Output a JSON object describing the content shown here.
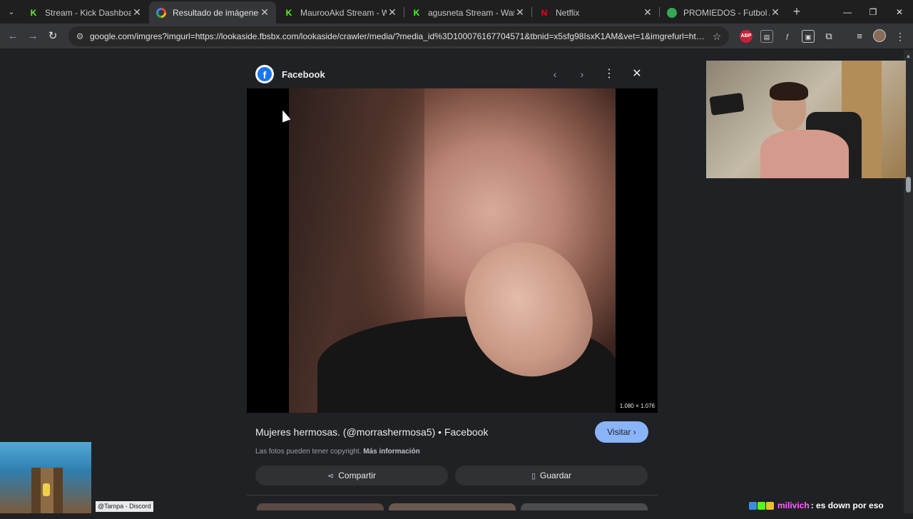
{
  "browser": {
    "tabs": [
      {
        "label": "Stream - Kick Dashboard",
        "icon": "kick-icon"
      },
      {
        "label": "Resultado de imágenes de G",
        "icon": "google-icon"
      },
      {
        "label": "MaurooAkd Stream - Watch",
        "icon": "kick-icon"
      },
      {
        "label": "agusneta Stream - Watch Liv",
        "icon": "kick-icon"
      },
      {
        "label": "Netflix",
        "icon": "netflix-icon"
      },
      {
        "label": "PROMIEDOS - Futbol Argent",
        "icon": "promiedos-icon"
      }
    ],
    "url": "google.com/imgres?imgurl=https://lookaside.fbsbx.com/lookaside/crawler/media/?media_id%3D100076167704571&tbnid=x5sfg98IsxK1AM&vet=1&imgrefurl=https://www...",
    "extensions": [
      "ABP",
      "reader-icon",
      "script-icon",
      "media-icon",
      "puzzle-icon",
      "queue-icon"
    ]
  },
  "panel": {
    "source": "Facebook",
    "image_dims": "1.080 × 1.076",
    "caption": "Mujeres hermosas. (@morrashermosa5) • Facebook",
    "visit_label": "Visitar",
    "copyright_text": "Las fotos pueden tener copyright.",
    "more_info": "Más información",
    "share_label": "Compartir",
    "save_label": "Guardar"
  },
  "overlay": {
    "discord_tag": "@Tampa - Discord",
    "chat_user": "milivich",
    "chat_message": ": es down por eso"
  }
}
